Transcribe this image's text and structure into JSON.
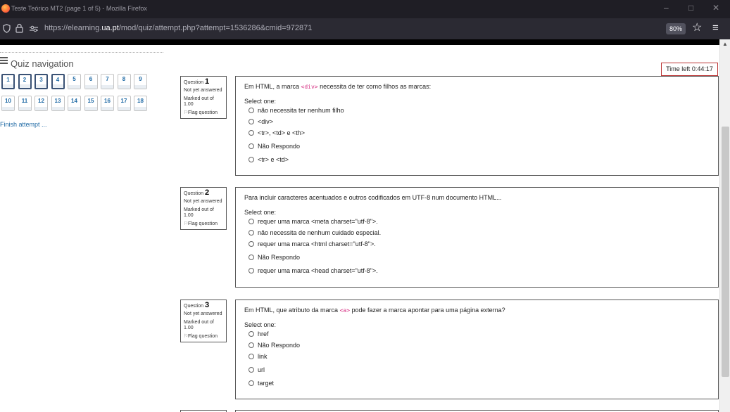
{
  "browser": {
    "window_title": "Teste Teórico MT2 (page 1 of 5) - Mozilla Firefox",
    "url_prefix": "https://elearning.",
    "url_domain": "ua.pt",
    "url_suffix": "/mod/quiz/attempt.php?attempt=1536286&cmid=972871",
    "zoom": "80%",
    "controls": {
      "minimize": "–",
      "maximize": "□",
      "close": "✕"
    },
    "icons": {
      "shield": "shield-icon",
      "lock": "lock-icon",
      "permissions": "permissions-icon",
      "star": "star-icon",
      "menu": "hamburger-menu-icon"
    }
  },
  "quiz_nav": {
    "title": "Quiz navigation",
    "buttons": [
      "1",
      "2",
      "3",
      "4",
      "5",
      "6",
      "7",
      "8",
      "9",
      "10",
      "11",
      "12",
      "13",
      "14",
      "15",
      "16",
      "17",
      "18"
    ],
    "seen": [
      1,
      2,
      3,
      4
    ],
    "finish": "Finish attempt ..."
  },
  "timer": "Time left 0:44:17",
  "questions": [
    {
      "label": "Question",
      "number": "1",
      "state": "Not yet answered",
      "marks": "Marked out of 1.00",
      "flag": "Flag question",
      "text_before": "Em HTML, a marca ",
      "code": "<div>",
      "text_after": " necessita de ter como filhos as marcas:",
      "prompt": "Select one:",
      "options": [
        "não necessita ter nenhum filho",
        "<div>",
        "<tr>, <td> e <th>",
        "Não Respondo",
        "<tr> e <td>"
      ]
    },
    {
      "label": "Question",
      "number": "2",
      "state": "Not yet answered",
      "marks": "Marked out of 1.00",
      "flag": "Flag question",
      "text_before": "Para incluir caracteres acentuados e outros codificados em UTF-8 num documento HTML...",
      "code": "",
      "text_after": "",
      "prompt": "Select one:",
      "options": [
        "requer uma marca <meta charset=\"utf-8\">.",
        "não necessita de nenhum cuidado especial.",
        "requer uma marca <html charset=\"utf-8\">.",
        "Não Respondo",
        "requer uma marca <head charset=\"utf-8\">."
      ]
    },
    {
      "label": "Question",
      "number": "3",
      "state": "Not yet answered",
      "marks": "Marked out of 1.00",
      "flag": "Flag question",
      "text_before": "Em HTML, que atributo da marca ",
      "code": "<a>",
      "text_after": " pode fazer a marca apontar para uma página externa?",
      "prompt": "Select one:",
      "options": [
        "href",
        "Não Respondo",
        "link",
        "url",
        "target"
      ]
    }
  ]
}
